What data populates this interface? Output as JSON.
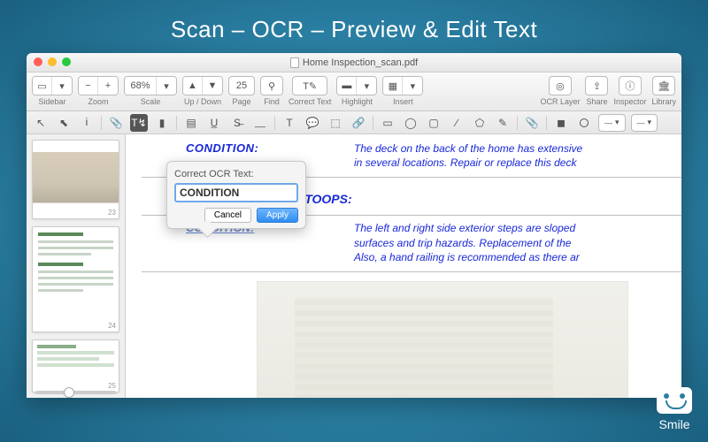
{
  "promo": {
    "title": "Scan – OCR – Preview & Edit Text"
  },
  "window": {
    "title": "Home Inspection_scan.pdf"
  },
  "toolbar": {
    "sidebar": "Sidebar",
    "zoom": "Zoom",
    "zoom_value": "68%",
    "scale": "Scale",
    "updown": "Up / Down",
    "page": "Page",
    "page_value": "25",
    "find": "Find",
    "correct_text": "Correct Text",
    "highlight": "Highlight",
    "insert": "Insert",
    "ocr_layer": "OCR Layer",
    "share": "Share",
    "inspector": "Inspector",
    "library": "Library"
  },
  "thumbs": {
    "p1": "23",
    "p2": "24",
    "p3": "25"
  },
  "doc": {
    "cond_label": "CONDITION:",
    "row1": "The deck on the back of the home has extensive\nin several locations. Repair or replace this deck",
    "section": "TAIRS/STOOPS:",
    "row2_sel": "CONDITION:",
    "row2": "The left and right side exterior steps are sloped\nsurfaces and trip hazards. Replacement of the\nAlso, a hand railing is recommended as there ar"
  },
  "popover": {
    "label": "Correct OCR Text:",
    "value": "CONDITION",
    "cancel": "Cancel",
    "apply": "Apply"
  },
  "brand": "Smile"
}
